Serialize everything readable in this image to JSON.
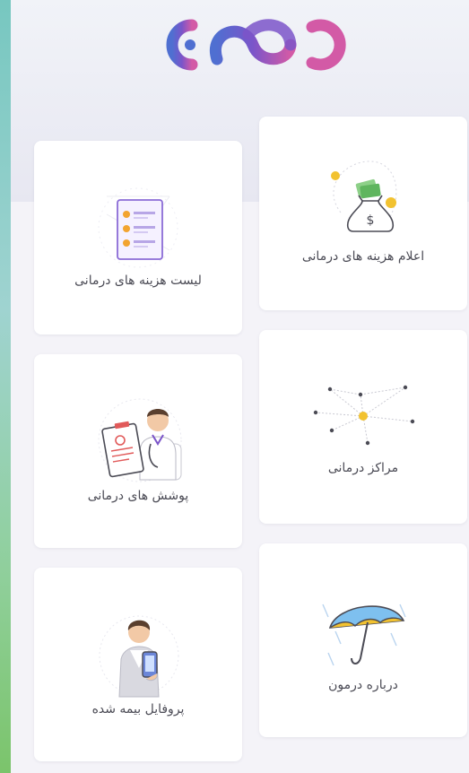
{
  "brand": {
    "logo_icon": "dormoon-logo",
    "colors": {
      "purple": "#7b55c9",
      "blue": "#4f6fd1",
      "pink": "#d35aa6"
    }
  },
  "menu": {
    "items": [
      {
        "key": "expense_report",
        "label": "اعلام هزینه های درمانی",
        "icon": "money-bag-icon"
      },
      {
        "key": "expense_list",
        "label": "لیست هزینه های درمانی",
        "icon": "checklist-icon"
      },
      {
        "key": "centers",
        "label": "مراکز درمانی",
        "icon": "network-icon"
      },
      {
        "key": "coverages",
        "label": "پوشش های درمانی",
        "icon": "doctor-clipboard-icon"
      },
      {
        "key": "about",
        "label": "درباره درمون",
        "icon": "umbrella-icon"
      },
      {
        "key": "profile",
        "label": "پروفایل بیمه شده",
        "icon": "user-phone-icon"
      }
    ]
  }
}
